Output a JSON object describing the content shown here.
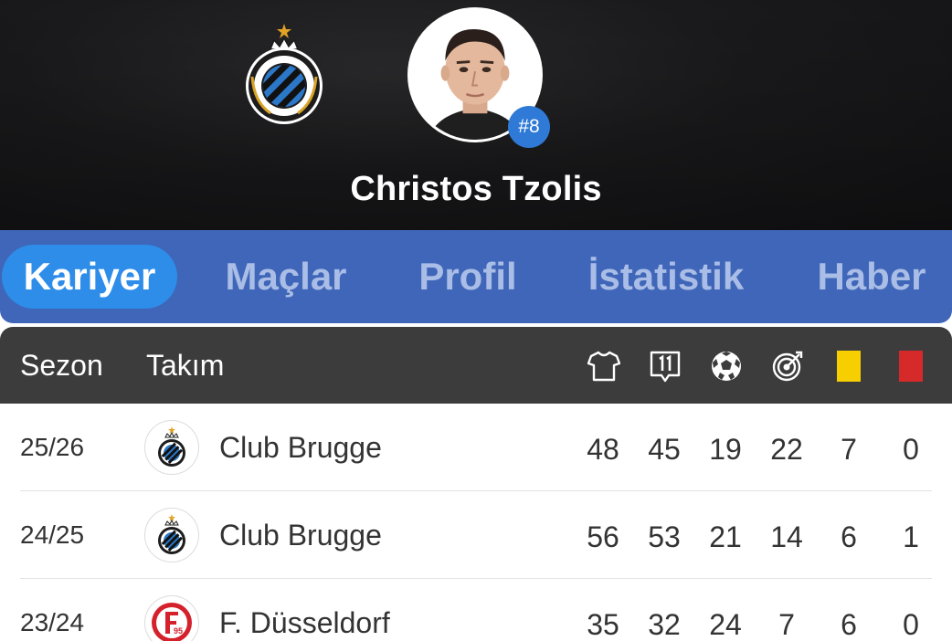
{
  "player": {
    "name": "Christos Tzolis",
    "number": "#8",
    "club_crest_icon": "club-brugge-crest-icon"
  },
  "tabs": [
    {
      "label": "Kariyer",
      "active": true
    },
    {
      "label": "Maçlar",
      "active": false
    },
    {
      "label": "Profil",
      "active": false
    },
    {
      "label": "İstatistik",
      "active": false
    },
    {
      "label": "Haber",
      "active": false
    }
  ],
  "table": {
    "headers": {
      "season": "Sezon",
      "team": "Takım",
      "icons": [
        "shirt-icon",
        "lineup-icon",
        "ball-icon",
        "target-icon",
        "yellow-card-icon",
        "red-card-icon"
      ]
    },
    "rows": [
      {
        "season": "25/26",
        "team": "Club Brugge",
        "logo": "club-brugge-logo-icon",
        "stats": [
          "48",
          "45",
          "19",
          "22",
          "7",
          "0"
        ]
      },
      {
        "season": "24/25",
        "team": "Club Brugge",
        "logo": "club-brugge-logo-icon",
        "stats": [
          "56",
          "53",
          "21",
          "14",
          "6",
          "1"
        ]
      },
      {
        "season": "23/24",
        "team": "F. Düsseldorf",
        "logo": "fortuna-dusseldorf-logo-icon",
        "stats": [
          "35",
          "32",
          "24",
          "7",
          "6",
          "0"
        ]
      }
    ]
  },
  "colors": {
    "tabbar": "#3f66b8",
    "active_tab": "#2d8de9",
    "badge": "#2f7ad6",
    "yellow_card": "#f7cf00",
    "red_card": "#d62a2a"
  }
}
